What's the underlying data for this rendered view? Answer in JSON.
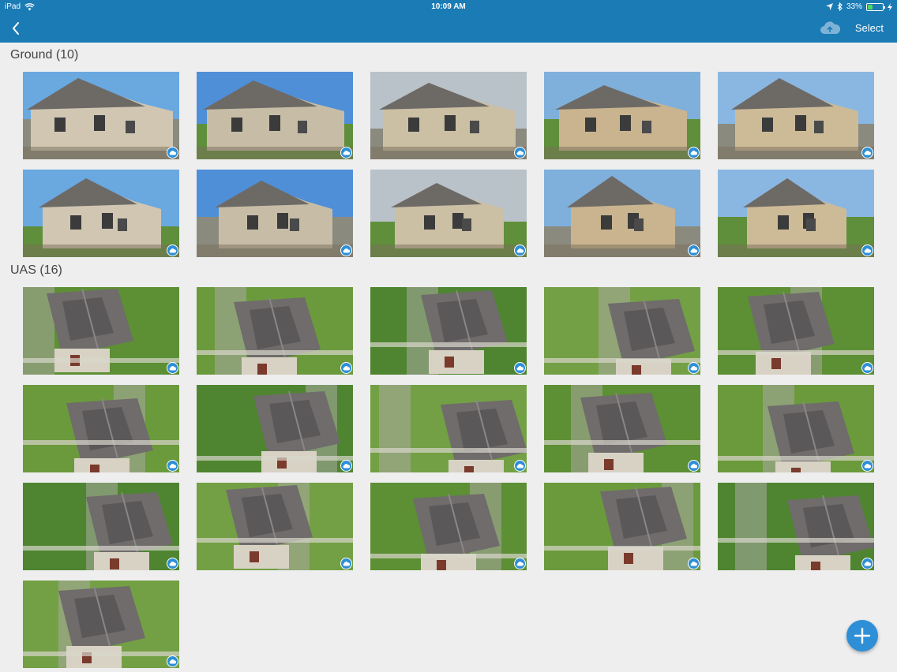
{
  "status_bar": {
    "device": "iPad",
    "time": "10:09 AM",
    "battery_percent": 33,
    "battery_label": "33%",
    "icons": [
      "wifi-icon",
      "location-icon",
      "bluetooth-icon",
      "battery-icon",
      "charging-icon"
    ]
  },
  "nav": {
    "back_icon": "chevron-left-icon",
    "cloud_icon": "cloud-upload-icon",
    "select_label": "Select"
  },
  "sections": [
    {
      "title": "Ground (10)",
      "kind": "ground",
      "photo_count": 10
    },
    {
      "title": "UAS (16)",
      "kind": "uas",
      "photo_count": 16
    }
  ],
  "thumbnail_badge_icon": "cloud-synced-icon",
  "fab": {
    "icon": "plus-icon"
  },
  "colors": {
    "header": "#1a7bb5",
    "accent": "#2e8fd6",
    "background": "#eeeeef",
    "section_text": "#444444"
  }
}
